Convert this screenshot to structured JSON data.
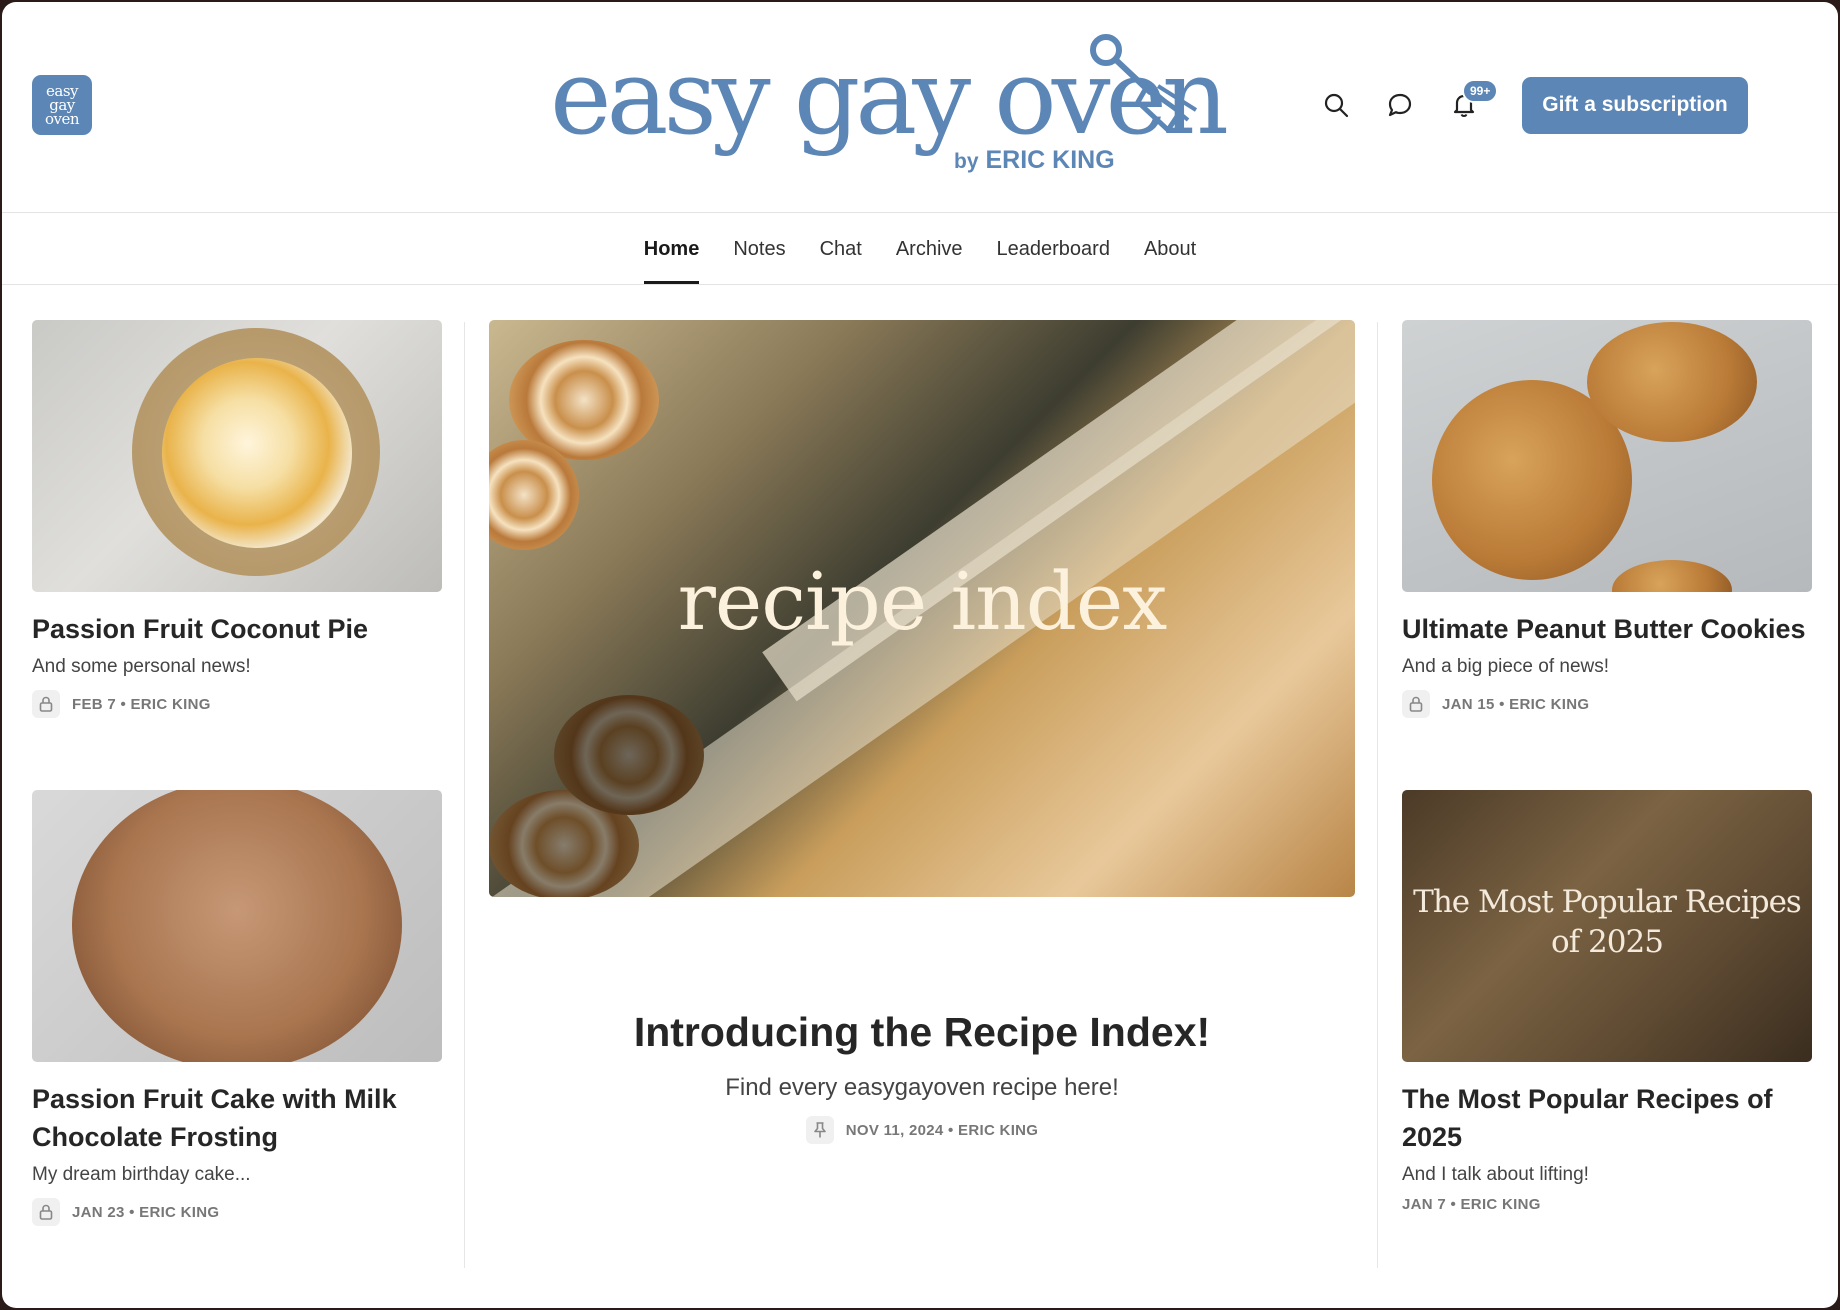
{
  "header": {
    "logo_lines": [
      "easy",
      "gay",
      "oven"
    ],
    "title": "easy gay oven",
    "byline_by": "by",
    "byline_name": "ERIC KING",
    "notification_count": "99+",
    "gift_label": "Gift a subscription",
    "brand_color": "#5b86b5",
    "icons": [
      "search-icon",
      "chat-icon",
      "bell-icon"
    ]
  },
  "nav": {
    "items": [
      {
        "label": "Home",
        "active": true
      },
      {
        "label": "Notes"
      },
      {
        "label": "Chat"
      },
      {
        "label": "Archive"
      },
      {
        "label": "Leaderboard"
      },
      {
        "label": "About"
      }
    ]
  },
  "posts": {
    "left": [
      {
        "title": "Passion Fruit Coconut Pie",
        "subtitle": "And some personal news!",
        "meta": "FEB 7 • ERIC KING",
        "icon": "lock-icon"
      },
      {
        "title": "Passion Fruit Cake with Milk Chocolate Frosting",
        "subtitle": "My dream birthday cake...",
        "meta": "JAN 23 • ERIC KING",
        "icon": "lock-icon"
      }
    ],
    "featured": {
      "image_text": "recipe index",
      "title": "Introducing the Recipe Index!",
      "subtitle": "Find every easygayoven recipe here!",
      "meta": "NOV 11, 2024 • ERIC KING",
      "icon": "pin-icon"
    },
    "right": [
      {
        "title": "Ultimate Peanut Butter Cookies",
        "subtitle": "And a big piece of news!",
        "meta": "JAN 15 • ERIC KING",
        "icon": "lock-icon"
      },
      {
        "image_text_1": "The Most Popular Recipes",
        "image_text_2": "of 2025",
        "title": "The Most Popular Recipes of 2025",
        "subtitle": "And I talk about lifting!",
        "meta": "JAN 7 • ERIC KING"
      }
    ]
  }
}
